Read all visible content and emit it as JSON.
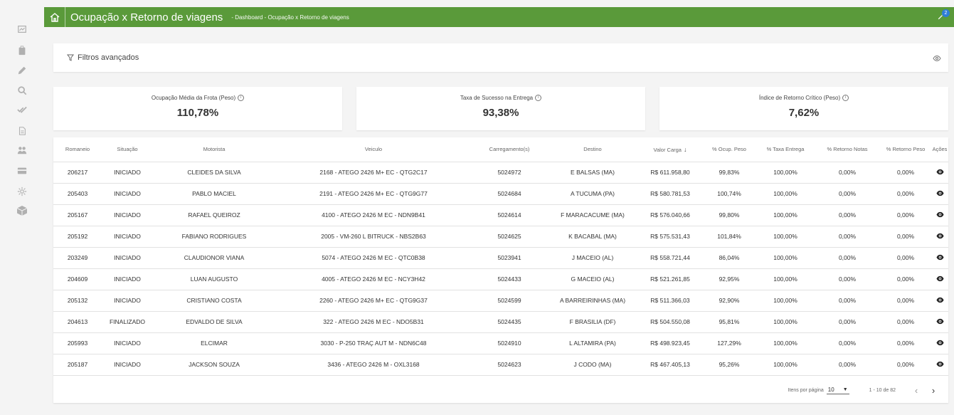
{
  "header": {
    "title": "Ocupação x Retorno de viagens",
    "breadcrumb": "- Dashboard - Ocupação x Retorno de viagens",
    "notification_count": "2",
    "bg_color": "#5a9a3a"
  },
  "sidebar": {
    "icons": [
      "chart-icon",
      "clipboard-icon",
      "pencil-icon",
      "search-icon",
      "double-check-icon",
      "document-icon",
      "people-icon",
      "card-icon",
      "gear-icon",
      "box-icon"
    ]
  },
  "filters": {
    "label": "Filtros avançados"
  },
  "kpis": [
    {
      "label": "Ocupação Média da Frota (Peso)",
      "value": "110,78%"
    },
    {
      "label": "Taxa de Sucesso na Entrega",
      "value": "93,38%"
    },
    {
      "label": "Índice de Retorno Crítico (Peso)",
      "value": "7,62%"
    }
  ],
  "table": {
    "columns": [
      "Romaneio",
      "Situação",
      "Motorista",
      "Veiculo",
      "Carregamento(s)",
      "Destino",
      "Valor Carga",
      "% Ocup. Peso",
      "% Taxa Entrega",
      "% Retorno Notas",
      "% Retorno Peso",
      "Ações"
    ],
    "rows": [
      [
        "206217",
        "INICIADO",
        "CLEIDES DA SILVA",
        "2168 - ATEGO 2426 M+ EC - QTG2C17",
        "5024972",
        "E BALSAS (MA)",
        "R$ 611.958,80",
        "99,83%",
        "100,00%",
        "0,00%",
        "0,00%"
      ],
      [
        "205403",
        "INICIADO",
        "PABLO MACIEL",
        "2191 - ATEGO 2426 M+ EC - QTG9G77",
        "5024684",
        "A TUCUMA (PA)",
        "R$ 580.781,53",
        "100,74%",
        "100,00%",
        "0,00%",
        "0,00%"
      ],
      [
        "205167",
        "INICIADO",
        "RAFAEL QUEIROZ",
        "4100 - ATEGO 2426 M EC - NDN9B41",
        "5024614",
        "F MARACACUME (MA)",
        "R$ 576.040,66",
        "99,80%",
        "100,00%",
        "0,00%",
        "0,00%"
      ],
      [
        "205192",
        "INICIADO",
        "FABIANO RODRIGUES",
        "2005 - VM-260 L BITRUCK - NBS2B63",
        "5024625",
        "K BACABAL (MA)",
        "R$ 575.531,43",
        "101,84%",
        "100,00%",
        "0,00%",
        "0,00%"
      ],
      [
        "203249",
        "INICIADO",
        "CLAUDIONOR VIANA",
        "5074 - ATEGO 2426 M EC - QTC0B38",
        "5023941",
        "J MACEIO (AL)",
        "R$ 558.721,44",
        "86,04%",
        "100,00%",
        "0,00%",
        "0,00%"
      ],
      [
        "204609",
        "INICIADO",
        "LUAN AUGUSTO",
        "4005 - ATEGO 2426 M EC - NCY3H42",
        "5024433",
        "G MACEIO (AL)",
        "R$ 521.261,85",
        "92,95%",
        "100,00%",
        "0,00%",
        "0,00%"
      ],
      [
        "205132",
        "INICIADO",
        "CRISTIANO COSTA",
        "2260 - ATEGO 2426 M+ EC - QTG9G37",
        "5024599",
        "A BARREIRINHAS (MA)",
        "R$ 511.366,03",
        "92,90%",
        "100,00%",
        "0,00%",
        "0,00%"
      ],
      [
        "204613",
        "FINALIZADO",
        "EDVALDO DE SILVA",
        "322 - ATEGO 2426 M EC - NDO5B31",
        "5024435",
        "F BRASILIA (DF)",
        "R$ 504.550,08",
        "95,81%",
        "100,00%",
        "0,00%",
        "0,00%"
      ],
      [
        "205993",
        "INICIADO",
        "ELCIMAR",
        "3030 - P-250 TRAÇ AUT M - NDN6C48",
        "5024910",
        "L ALTAMIRA (PA)",
        "R$ 498.923,45",
        "127,29%",
        "100,00%",
        "0,00%",
        "0,00%"
      ],
      [
        "205187",
        "INICIADO",
        "JACKSON SOUZA",
        "3436 - ATEGO 2426 M - OXL3168",
        "5024623",
        "J CODO (MA)",
        "R$ 467.405,13",
        "95,26%",
        "100,00%",
        "0,00%",
        "0,00%"
      ]
    ]
  },
  "pager": {
    "items_label": "Itens por página",
    "page_size": "10",
    "range": "1 - 10 de 82"
  }
}
